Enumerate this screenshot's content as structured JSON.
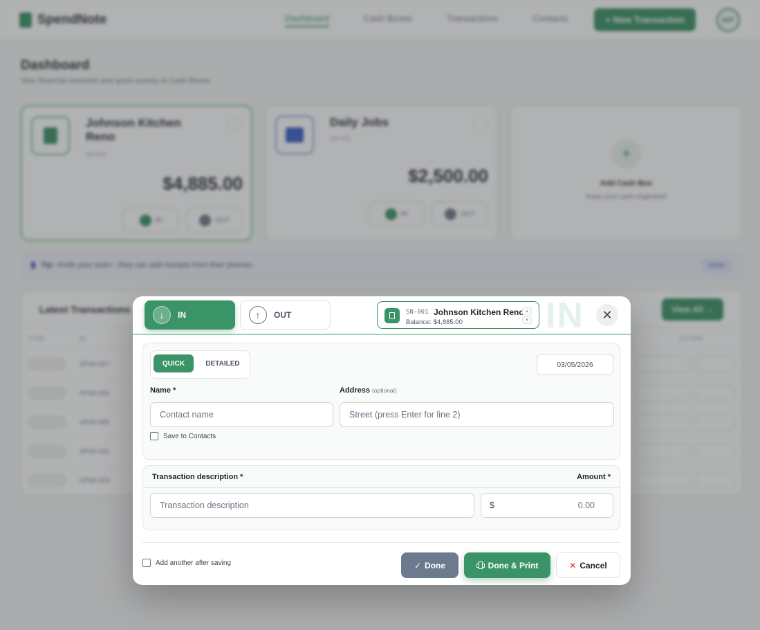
{
  "app": {
    "brand": "SpendNote",
    "nav": [
      "Dashboard",
      "Cash Boxes",
      "Transactions",
      "Contacts"
    ],
    "new_tx_label": "+ New Transaction",
    "avatar": "AVP",
    "page_title": "Dashboard",
    "page_subtitle": "Your financial overview and quick access to Cash Boxes",
    "cash_boxes": [
      {
        "name": "Johnson Kitchen Reno",
        "id": "SN-001",
        "balance": "$4,885.00",
        "in": "IN",
        "out": "OUT"
      },
      {
        "name": "Daily Jobs",
        "id": "SN-002",
        "balance": "$2,500.00",
        "in": "IN",
        "out": "OUT"
      }
    ],
    "add_box": {
      "title": "Add Cash Box",
      "subtitle": "Keep your cash organized"
    },
    "tip": {
      "label": "Tip:",
      "text": "Invite your team - they can add receipts from their phones.",
      "invite": "Invite"
    },
    "latest": {
      "title": "Latest Transactions",
      "view_all": "View All →",
      "columns": [
        "TYPE",
        "ID",
        "ACTION"
      ],
      "rows": [
        {
          "type": "out",
          "id": "SPND-007"
        },
        {
          "type": "in",
          "id": "SPND-006"
        },
        {
          "type": "in",
          "id": "SPND-005"
        },
        {
          "type": "in",
          "id": "SPND-004"
        },
        {
          "type": "out",
          "id": "SPND-003"
        }
      ]
    }
  },
  "modal": {
    "direction": {
      "in_label": "IN",
      "out_label": "OUT",
      "active": "IN",
      "big_label": "IN"
    },
    "cash_box": {
      "id": "SN-001",
      "name": "Johnson Kitchen Reno",
      "balance": "Balance: $4,885.00"
    },
    "mode": {
      "quick": "QUICK",
      "detailed": "DETAILED",
      "active": "QUICK"
    },
    "date": "03/05/2026",
    "name_label": "Name *",
    "name_placeholder": "Contact name",
    "address_label": "Address",
    "address_optional": "(optional)",
    "address_placeholder": "Street (press Enter for line 2)",
    "save_contact": "Save to Contacts",
    "description_label": "Transaction description *",
    "amount_label": "Amount *",
    "description_placeholder": "Transaction description",
    "currency": "$",
    "amount_placeholder": "0.00",
    "add_another": "Add another after saving",
    "done_label": "Done",
    "print_label": "Done & Print",
    "cancel_label": "Cancel"
  },
  "colors": {
    "brand": "#2e8b5c",
    "done": "#6c7a8e",
    "cancel_x": "#dc2626"
  }
}
